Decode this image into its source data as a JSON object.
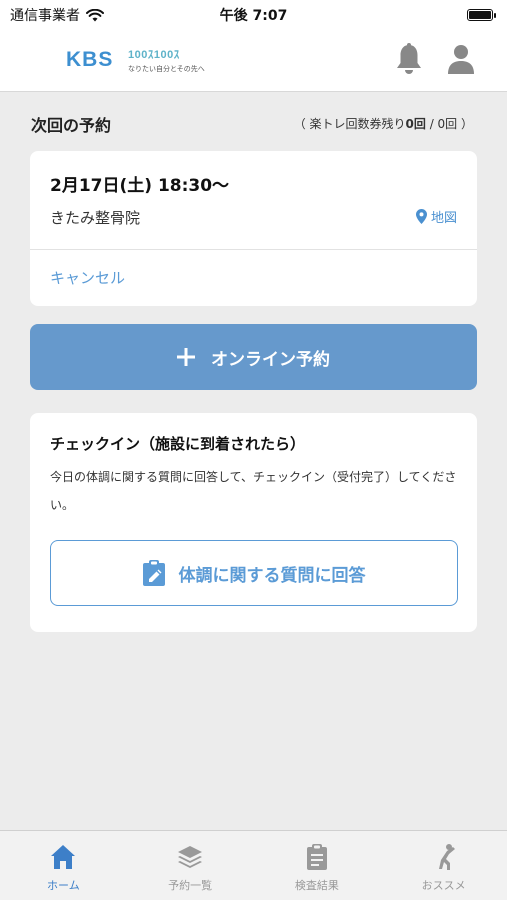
{
  "status_bar": {
    "carrier": "通信事業者",
    "time": "午後 7:07",
    "icons": [
      "wifi-icon",
      "battery-icon"
    ]
  },
  "header": {
    "logo_main": "KBS",
    "logo_sub_top": "100ｽ100ｽ",
    "logo_sub_bottom": "なりたい自分とその先へ",
    "icons": [
      "bell-icon",
      "user-icon"
    ]
  },
  "next_reservation": {
    "section_title": "次回の予約",
    "ticket_info_prefix": "（ 楽トレ回数券残り",
    "ticket_remaining": "0回",
    "ticket_info_suffix": " / 0回 ）",
    "date": "2月17日(土) 18:30〜",
    "place": "きたみ整骨院",
    "map_label": "地図",
    "cancel_label": "キャンセル"
  },
  "online_button": {
    "label": "オンライン予約",
    "icon": "plus-icon"
  },
  "checkin": {
    "title": "チェックイン（施設に到着されたら）",
    "description": "今日の体調に関する質問に回答して、チェックイン（受付完了）してください。",
    "button_label": "体調に関する質問に回答",
    "button_icon": "clipboard-edit-icon"
  },
  "tab_bar": {
    "items": [
      {
        "label": "ホーム",
        "icon": "home-icon",
        "active": true
      },
      {
        "label": "予約一覧",
        "icon": "layers-icon",
        "active": false
      },
      {
        "label": "検査結果",
        "icon": "clipboard-list-icon",
        "active": false
      },
      {
        "label": "おススメ",
        "icon": "person-stretch-icon",
        "active": false
      }
    ]
  },
  "colors": {
    "accent": "#6699cc",
    "link": "#5b9bd6",
    "background": "#ececec",
    "tab_active": "#3d7fc8",
    "tab_inactive": "#999999"
  }
}
